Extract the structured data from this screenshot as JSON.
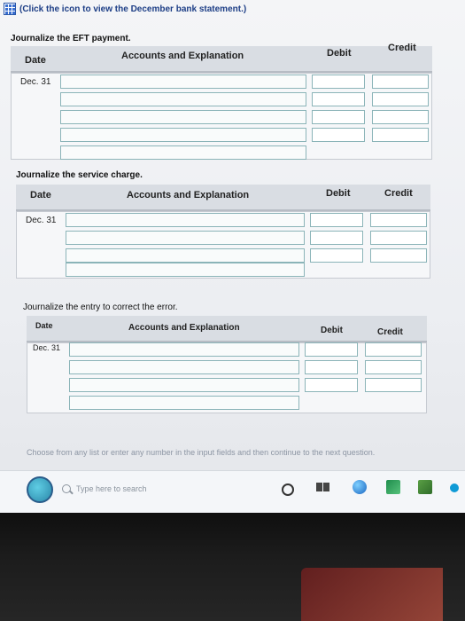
{
  "top_link": {
    "text": "(Click the icon to view the December bank statement.)"
  },
  "sections": [
    {
      "title": "Journalize the EFT payment.",
      "headers": {
        "date": "Date",
        "accounts": "Accounts and Explanation",
        "debit": "Debit",
        "credit": "Credit"
      },
      "date_value": "Dec. 31"
    },
    {
      "title": "Journalize the service charge.",
      "headers": {
        "date": "Date",
        "accounts": "Accounts and Explanation",
        "debit": "Debit",
        "credit": "Credit"
      },
      "date_value": "Dec. 31"
    },
    {
      "title": "Journalize the entry to correct the error.",
      "headers": {
        "date": "Date",
        "accounts": "Accounts and Explanation",
        "debit": "Debit",
        "credit": "Credit"
      },
      "date_value": "Dec. 31"
    }
  ],
  "hint": "Choose from any list or enter any number in the input fields and then continue to the next question.",
  "taskbar": {
    "search_placeholder": "Type here to search"
  }
}
